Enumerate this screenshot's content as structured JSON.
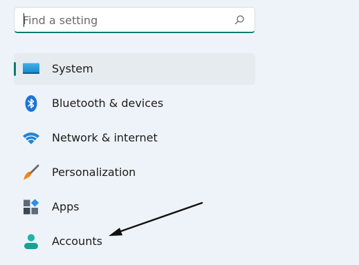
{
  "search": {
    "placeholder": "Find a setting",
    "value": "",
    "icon": "search-icon"
  },
  "nav": {
    "items": [
      {
        "label": "System",
        "icon": "system-icon",
        "selected": true
      },
      {
        "label": "Bluetooth & devices",
        "icon": "bluetooth-icon",
        "selected": false
      },
      {
        "label": "Network & internet",
        "icon": "wifi-icon",
        "selected": false
      },
      {
        "label": "Personalization",
        "icon": "brush-icon",
        "selected": false
      },
      {
        "label": "Apps",
        "icon": "apps-icon",
        "selected": false
      },
      {
        "label": "Accounts",
        "icon": "accounts-icon",
        "selected": false
      }
    ]
  },
  "colors": {
    "background": "#eef3f9",
    "accent": "#0f7b72",
    "selected_bg": "#e6ebef"
  }
}
